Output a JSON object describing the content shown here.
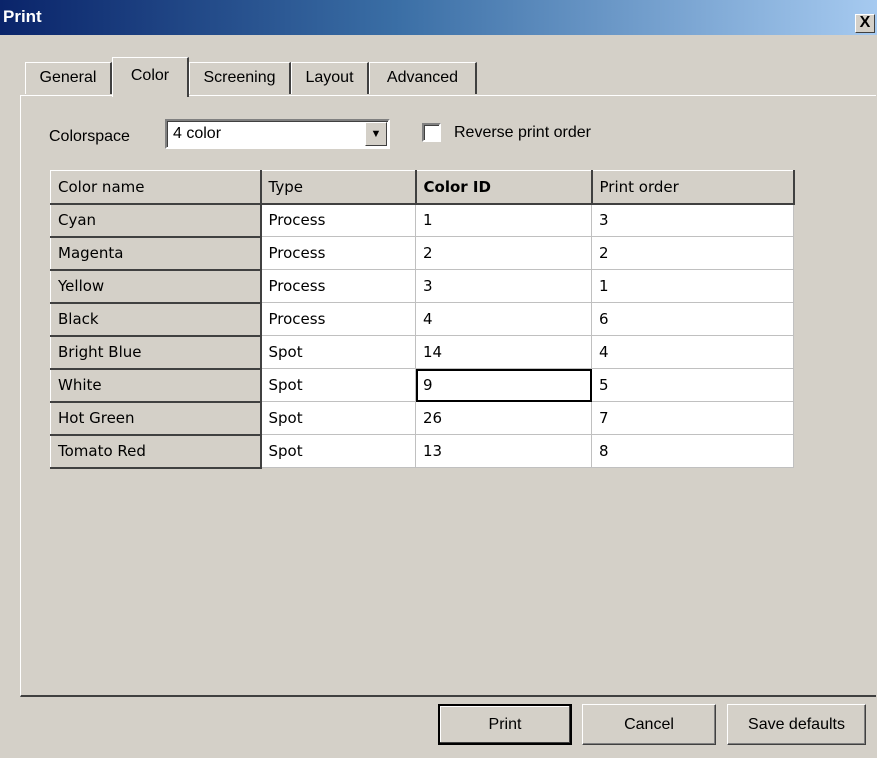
{
  "window": {
    "title": "Print",
    "close_label": "X"
  },
  "tabs": [
    {
      "label": "General"
    },
    {
      "label": "Color"
    },
    {
      "label": "Screening"
    },
    {
      "label": "Layout"
    },
    {
      "label": "Advanced"
    }
  ],
  "active_tab": "Color",
  "colorspace": {
    "label": "Colorspace",
    "value": "4 color"
  },
  "reverse_print_order": {
    "label": "Reverse print order",
    "checked": false
  },
  "table": {
    "columns": [
      "Color name",
      "Type",
      "Color ID",
      "Print order"
    ],
    "rows": [
      {
        "name": "Cyan",
        "type": "Process",
        "color_id": "1",
        "print_order": "3"
      },
      {
        "name": "Magenta",
        "type": "Process",
        "color_id": "2",
        "print_order": "2"
      },
      {
        "name": "Yellow",
        "type": "Process",
        "color_id": "3",
        "print_order": "1"
      },
      {
        "name": "Black",
        "type": "Process",
        "color_id": "4",
        "print_order": "6"
      },
      {
        "name": "Bright Blue",
        "type": "Spot",
        "color_id": "14",
        "print_order": "4"
      },
      {
        "name": "White",
        "type": "Spot",
        "color_id": "9",
        "print_order": "5"
      },
      {
        "name": "Hot Green",
        "type": "Spot",
        "color_id": "26",
        "print_order": "7"
      },
      {
        "name": "Tomato Red",
        "type": "Spot",
        "color_id": "13",
        "print_order": "8"
      }
    ]
  },
  "buttons": {
    "print": "Print",
    "cancel": "Cancel",
    "save_defaults": "Save defaults"
  },
  "colors": {
    "title_bar_start": "#0a246a",
    "title_bar_end": "#a6caf0",
    "face": "#d4d0c8"
  }
}
